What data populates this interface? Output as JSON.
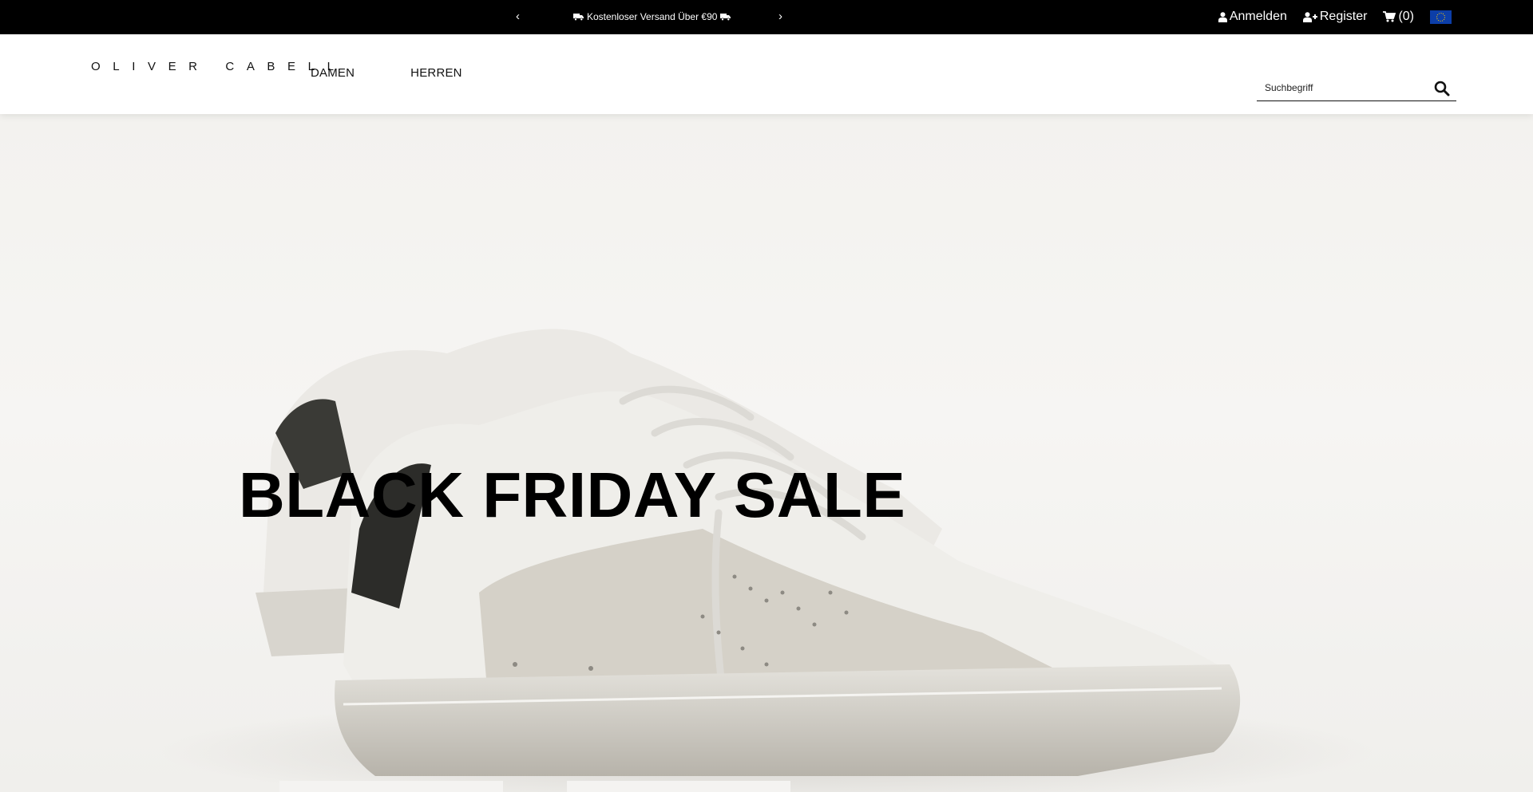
{
  "topbar": {
    "prev_label": "‹",
    "next_label": "›",
    "promo_text": "Kostenloser Versand Über €90",
    "promo_icon": "truck-icon",
    "login_label": "Anmelden",
    "register_label": "Register",
    "cart_label": "(0)",
    "region_flag": "eu-flag-icon"
  },
  "header": {
    "logo_text": "OLIVER CABELL",
    "nav": [
      {
        "label": "DAMEN"
      },
      {
        "label": "HERREN"
      }
    ],
    "search": {
      "placeholder": "Suchbegriff",
      "value": ""
    }
  },
  "hero": {
    "title": "BLACK FRIDAY SALE",
    "buttons": [
      {
        "label": ""
      },
      {
        "label": ""
      }
    ]
  },
  "colors": {
    "topbar_bg": "#000000",
    "flag_blue": "#0c3ea8",
    "flag_star": "#ffcc00",
    "hero_bg": "#f3f2ef"
  }
}
